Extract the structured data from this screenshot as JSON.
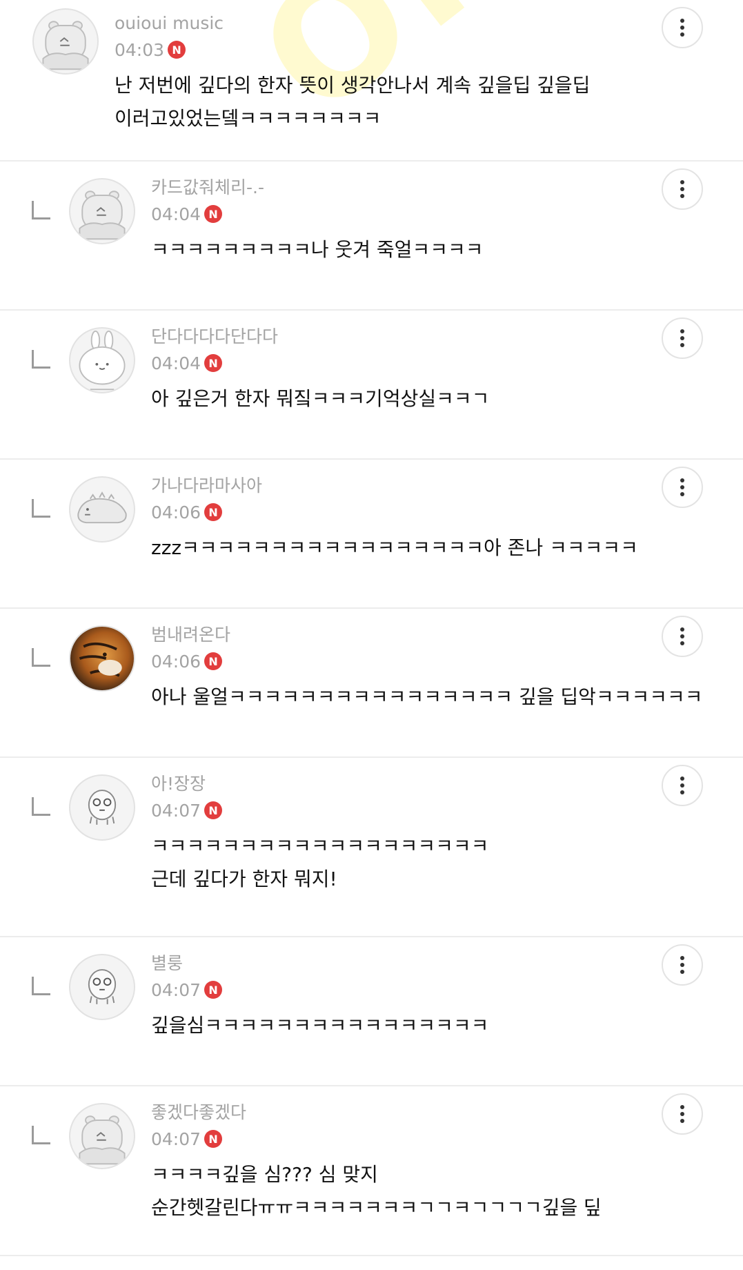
{
  "watermark": "OFM",
  "comments": [
    {
      "nick": "ouioui music",
      "time": "04:03",
      "badge": "N",
      "lines": [
        "난 저번에 깊다의 한자 뜻이 생각안나서 계속 깊을딥 깊을딥",
        "이러고있었는뎈ㅋㅋㅋㅋㅋㅋㅋㅋ"
      ],
      "avatar": "hippo-avatar",
      "reply": false
    },
    {
      "nick": "카드값줘체리-.-",
      "time": "04:04",
      "badge": "N",
      "lines": [
        "ㅋㅋㅋㅋㅋㅋㅋㅋㅋ나 웃겨 죽얼ㅋㅋㅋㅋ"
      ],
      "avatar": "hippo-avatar",
      "reply": true
    },
    {
      "nick": "단다다다다단다다",
      "time": "04:04",
      "badge": "N",
      "lines": [
        "아 깊은거 한자 뭐짘ㅋㅋㅋ기억상실ㅋㅋㄱ"
      ],
      "avatar": "rabbit-avatar",
      "reply": true
    },
    {
      "nick": "가나다라마사아",
      "time": "04:06",
      "badge": "N",
      "lines": [
        "zzzㅋㅋㅋㅋㅋㅋㅋㅋㅋㅋㅋㅋㅋㅋㅋㅋㅋ아 존나 ㅋㅋㅋㅋㅋ"
      ],
      "avatar": "dinosaur-avatar",
      "reply": true
    },
    {
      "nick": "범내려온다",
      "time": "04:06",
      "badge": "N",
      "lines": [
        "아나 울얼ㅋㅋㅋㅋㅋㅋㅋㅋㅋㅋㅋㅋㅋㅋㅋㅋ 깊을 딥악ㅋㅋㅋㅋㅋㅋ"
      ],
      "avatar": "tiger-photo-avatar",
      "reply": true
    },
    {
      "nick": "아!장장",
      "time": "04:07",
      "badge": "N",
      "lines": [
        "ㅋㅋㅋㅋㅋㅋㅋㅋㅋㅋㅋㅋㅋㅋㅋㅋㅋㅋㅋ",
        "근데 깊다가 한자 뭐지!"
      ],
      "avatar": "ghost-avatar",
      "reply": true
    },
    {
      "nick": "별룽",
      "time": "04:07",
      "badge": "N",
      "lines": [
        "깊을심ㅋㅋㅋㅋㅋㅋㅋㅋㅋㅋㅋㅋㅋㅋㅋㅋ"
      ],
      "avatar": "ghost-avatar",
      "reply": true
    },
    {
      "nick": "좋겠다좋겠다",
      "time": "04:07",
      "badge": "N",
      "lines": [
        "ㅋㅋㅋㅋ깊을 심??? 심 맞지",
        "순간헷갈린다ㅠㅠㅋㅋㅋㅋㅋㅋㅋㄱㄱㅋㄱㄱㄱㄱ깊을 딮"
      ],
      "avatar": "hippo-avatar",
      "reply": true
    }
  ]
}
